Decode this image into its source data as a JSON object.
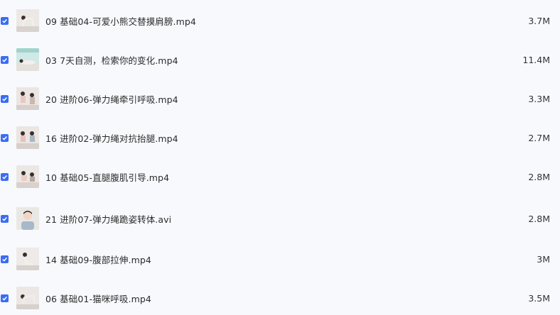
{
  "files": [
    {
      "name": "09 基础04-可爱小熊交替摸肩膀.mp4",
      "size": "3.7M",
      "checked": true,
      "thumb_icon": "exercise-thumbnail"
    },
    {
      "name": "03 7天自测，检索你的变化.mp4",
      "size": "11.4M",
      "checked": true,
      "thumb_icon": "exercise-thumbnail"
    },
    {
      "name": "20 进阶06-弹力绳牵引呼吸.mp4",
      "size": "3.3M",
      "checked": true,
      "thumb_icon": "exercise-thumbnail"
    },
    {
      "name": "16 进阶02-弹力绳对抗抬腿.mp4",
      "size": "2.7M",
      "checked": true,
      "thumb_icon": "exercise-thumbnail"
    },
    {
      "name": "10 基础05-直腿腹肌引导.mp4",
      "size": "2.8M",
      "checked": true,
      "thumb_icon": "exercise-thumbnail"
    },
    {
      "name": "21 进阶07-弹力绳跪姿转体.avi",
      "size": "2.8M",
      "checked": true,
      "thumb_icon": "instructor-thumbnail"
    },
    {
      "name": "14 基础09-腹部拉伸.mp4",
      "size": "3M",
      "checked": true,
      "thumb_icon": "exercise-thumbnail"
    },
    {
      "name": "06 基础01-猫咪呼吸.mp4",
      "size": "3.5M",
      "checked": true,
      "thumb_icon": "exercise-thumbnail"
    }
  ],
  "colors": {
    "checkbox": "#3b6cf5",
    "background": "#f8f9fd"
  }
}
